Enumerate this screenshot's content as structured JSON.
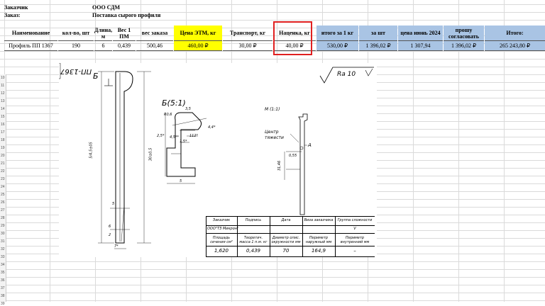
{
  "sheet": {
    "customer_label": "Заказчик",
    "customer_value": "ООО СДМ",
    "order_label": "Заказ:",
    "order_value": "Поставка сырого профиля"
  },
  "table": {
    "headers": [
      "Наименование",
      "кол-во, шт",
      "Длина, м",
      "Вес 1 ПМ",
      "вес заказа",
      "Цена ЭТМ, кг",
      "Транспорт, кг",
      "Наценка, кг",
      "итого за 1 кг",
      "за шт",
      "цена июнь 2024",
      "прошу согласовать",
      "Итого:"
    ],
    "row": [
      "Профиль ПП 1367",
      "190",
      "6",
      "0,439",
      "500,46",
      "460,00 ₽",
      "30,00 ₽",
      "40,00 ₽",
      "530,00 ₽",
      "1 396,02 ₽",
      "1 307,94",
      "1 396,02 ₽",
      "265 243,80 ₽"
    ]
  },
  "row_numbers": [
    "10",
    "11",
    "12",
    "13",
    "14",
    "15",
    "16",
    "17",
    "18",
    "19",
    "20",
    "21",
    "22",
    "23",
    "24",
    "25",
    "26",
    "27",
    "28",
    "29",
    "30",
    "31",
    "32",
    "33",
    "34",
    "35",
    "36",
    "37",
    "38",
    "39"
  ],
  "drawing": {
    "part_mark": "ПП-1367",
    "view_b": "Б",
    "view_b_detail": "Б(5:1)",
    "view_m": "М (1:1)",
    "roughness": "Ra 10",
    "center_label_1": "Центр",
    "center_label_2": "тяжести",
    "point_a": "А",
    "dim_total": "5/4,5±05",
    "dim_inner": "30±0,5",
    "dim_5": "5",
    "dim_6": "6",
    "dim_2": "2",
    "dim_7": "7*",
    "dim_r06": "R0,6",
    "dim_35": "3,5",
    "dim_44": "4,4*",
    "dim_25": "2,5*",
    "dim_45": "4,5**",
    "dim_15": "1,5*",
    "dim_112": "112°",
    "dim_d5": "5",
    "dim_055": "0,55",
    "dim_3146": "31,46"
  },
  "stamp": {
    "h_customer": "Заказчик",
    "h_sign": "Подпись",
    "h_date": "Дата",
    "h_visa": "Виза заказчика",
    "h_group": "Группа сложности",
    "v_customer": "ООО\"ТЗ Микрон\"",
    "v_group": "V",
    "h_area": "Площадь сечения см²",
    "h_mass": "Теоретич. масса 1 п.м. кг",
    "h_diam": "Диаметр опис. окружности мм",
    "h_perim_out": "Периметр наружный мм",
    "h_perim_in": "Периметр внутренний мм",
    "v_area": "1,620",
    "v_mass": "0,439",
    "v_diam": "70",
    "v_perim_out": "164,9",
    "v_perim_in": "–"
  }
}
